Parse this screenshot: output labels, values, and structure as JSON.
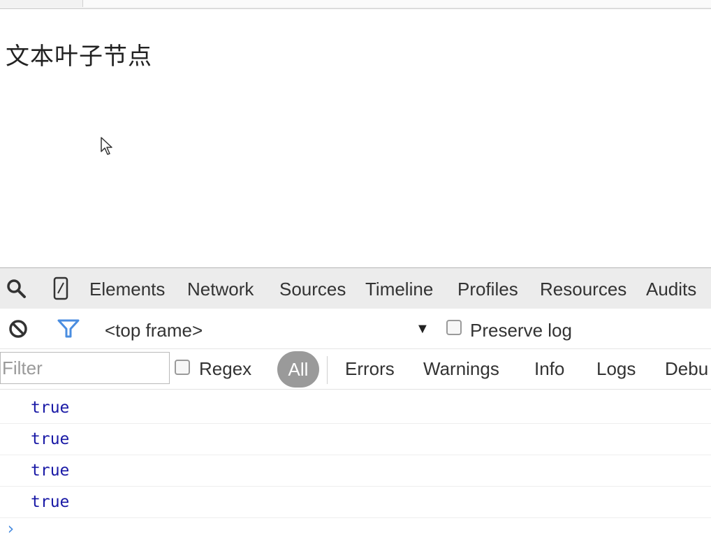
{
  "page": {
    "text": "文本叶子节点"
  },
  "devtools": {
    "tabs": [
      "Elements",
      "Network",
      "Sources",
      "Timeline",
      "Profiles",
      "Resources",
      "Audits"
    ],
    "toolbar": {
      "frame": "<top frame>",
      "preserve_log": "Preserve log",
      "preserve_log_checked": false
    },
    "filter": {
      "placeholder": "Filter",
      "value": "",
      "regex": "Regex",
      "regex_checked": false,
      "levels": [
        "All",
        "Errors",
        "Warnings",
        "Info",
        "Logs",
        "Debu"
      ],
      "active_level": "All"
    },
    "messages": [
      "true",
      "true",
      "true",
      "true"
    ],
    "prompt": "›"
  },
  "colors": {
    "accent": "#4a8de0",
    "log_value": "#1a1aa6",
    "active_pill": "#9a9a9a"
  },
  "icons": [
    "search-icon",
    "device-mode-icon",
    "clear-console-icon",
    "filter-icon",
    "dropdown-arrow-icon",
    "mouse-cursor-icon"
  ]
}
